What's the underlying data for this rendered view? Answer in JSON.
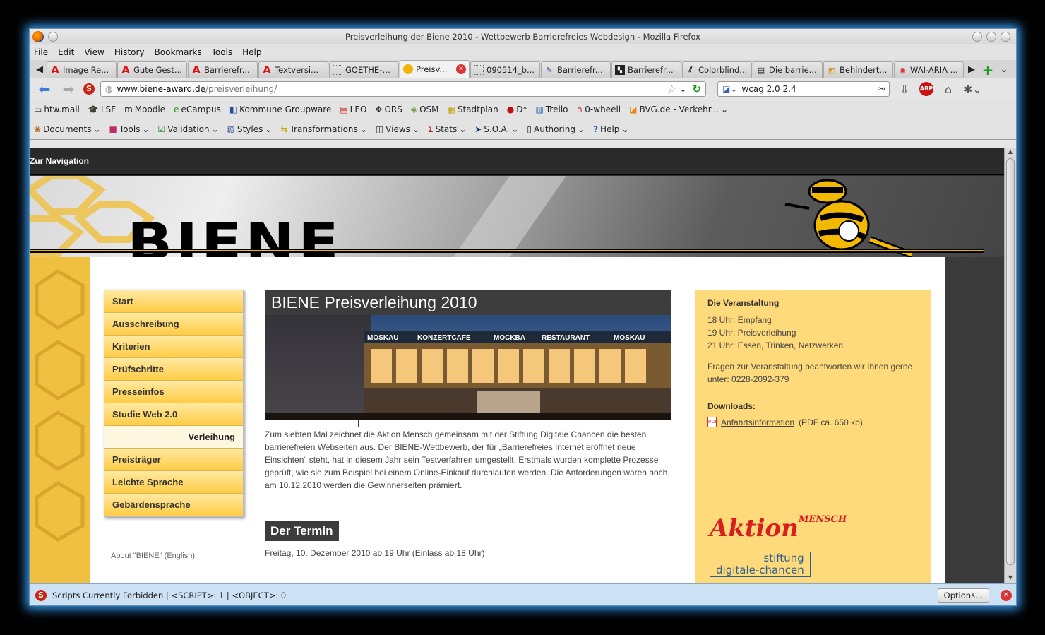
{
  "window": {
    "title": "Preisverleihung der Biene 2010 - Wettbewerb Barrierefreies Webdesign - Mozilla Firefox"
  },
  "menu": [
    "File",
    "Edit",
    "View",
    "History",
    "Bookmarks",
    "Tools",
    "Help"
  ],
  "tabs": [
    {
      "label": "Image Re...",
      "icon": "red-a"
    },
    {
      "label": "Gute Gest...",
      "icon": "red-a"
    },
    {
      "label": "Barrierefr...",
      "icon": "red-a"
    },
    {
      "label": "Textversi...",
      "icon": "red-a"
    },
    {
      "label": "GOETHE-Z...",
      "icon": "dotted"
    },
    {
      "label": "Preisv...",
      "icon": "bee",
      "active": true
    },
    {
      "label": "090514_b...",
      "icon": "dotted"
    },
    {
      "label": "Barrierefr...",
      "icon": "pen"
    },
    {
      "label": "Barrierefr...",
      "icon": "squares"
    },
    {
      "label": "Colorblind...",
      "icon": "chart"
    },
    {
      "label": "Die barrie...",
      "icon": "page"
    },
    {
      "label": "Behindert...",
      "icon": "img"
    },
    {
      "label": "WAI-ARIA ...",
      "icon": "ring"
    }
  ],
  "url": {
    "domain": "www.biene-award.de",
    "path": "/preisverleihung/"
  },
  "search": {
    "value": "wcag 2.0 2.4"
  },
  "bookmarks": [
    {
      "label": "htw.mail",
      "icon": "▭"
    },
    {
      "label": "LSF",
      "icon": "🎓"
    },
    {
      "label": "Moodle",
      "icon": "m"
    },
    {
      "label": "eCampus",
      "icon": "e"
    },
    {
      "label": "Kommune Groupware",
      "icon": "◧"
    },
    {
      "label": "LEO",
      "icon": "▤"
    },
    {
      "label": "ORS",
      "icon": "✥"
    },
    {
      "label": "OSM",
      "icon": "◈"
    },
    {
      "label": "Stadtplan",
      "icon": "▦"
    },
    {
      "label": "D*",
      "icon": "●"
    },
    {
      "label": "Trello",
      "icon": "▥"
    },
    {
      "label": "0-wheeli",
      "icon": "∩"
    },
    {
      "label": "BVG.de - Verkehr...",
      "icon": "◪"
    }
  ],
  "devbar": [
    {
      "label": "Documents",
      "icon": "❀"
    },
    {
      "label": "Tools",
      "icon": "■"
    },
    {
      "label": "Validation",
      "icon": "☑"
    },
    {
      "label": "Styles",
      "icon": "▨"
    },
    {
      "label": "Transformations",
      "icon": "⇆"
    },
    {
      "label": "Views",
      "icon": "◫"
    },
    {
      "label": "Stats",
      "icon": "Σ"
    },
    {
      "label": "S.O.A.",
      "icon": "➤"
    },
    {
      "label": "Authoring",
      "icon": "▯"
    },
    {
      "label": "Help",
      "icon": "?"
    }
  ],
  "site": {
    "skip_link": "Zur Navigation",
    "logo": "BIENE",
    "nav": [
      "Start",
      "Ausschreibung",
      "Kriterien",
      "Prüfschritte",
      "Presseinfos",
      "Studie Web 2.0",
      "Verleihung",
      "Preisträger",
      "Leichte Sprache",
      "Gebärdensprache"
    ],
    "nav_active_index": 6,
    "about_link": "About \"BIENE\" (English)",
    "headline": "BIENE Preisverleihung 2010",
    "hero_signs": [
      "MOSKAU",
      "KONZERTCAFE",
      "MOCKBA",
      "RESTAURANT",
      "MOSKAU"
    ],
    "intro": "Zum siebten Mal zeichnet die Aktion Mensch gemeinsam mit der Stiftung Digitale Chancen die besten barrierefreien Webseiten aus. Der BIENE-Wettbewerb, der für „Barrierefreies Internet eröffnet neue Einsichten“ steht, hat in diesem Jahr sein Testverfahren umgestellt. Erstmals wurden komplette Prozesse geprüft, wie sie zum Beispiel bei einem Online-Einkauf durchlaufen werden. Die Anforderungen waren hoch, am 10.12.2010 werden die Gewinnerseiten prämiert.",
    "termin_heading": "Der Termin",
    "termin_text": "Freitag, 10. Dezember 2010 ab 19 Uhr (Einlass ab 18 Uhr)",
    "aside": {
      "heading": "Die Veranstaltung",
      "schedule": [
        "18 Uhr: Empfang",
        "19 Uhr: Preisverleihung",
        "21 Uhr: Essen, Trinken, Netzwerken"
      ],
      "contact": "Fragen zur Veranstaltung beantworten wir Ihnen gerne unter: 0228-2092-379",
      "downloads_heading": "Downloads:",
      "download_link": "Anfahrtsinformation",
      "download_meta": "(PDF ca. 650 kb)",
      "logo_aktion": "Aktion",
      "logo_mensch": "MENSCH",
      "logo_stiftung_1": "stiftung",
      "logo_stiftung_2": "digitale-chancen"
    }
  },
  "statusbar": {
    "text": "Scripts Currently Forbidden | <SCRIPT>: 1 | <OBJECT>: 0",
    "options": "Options..."
  },
  "colors": {
    "accent_yellow": "#f3b800",
    "nav_yellow": "#ffcc45",
    "dark": "#3c3c3c",
    "glow": "#3aa4ff"
  }
}
